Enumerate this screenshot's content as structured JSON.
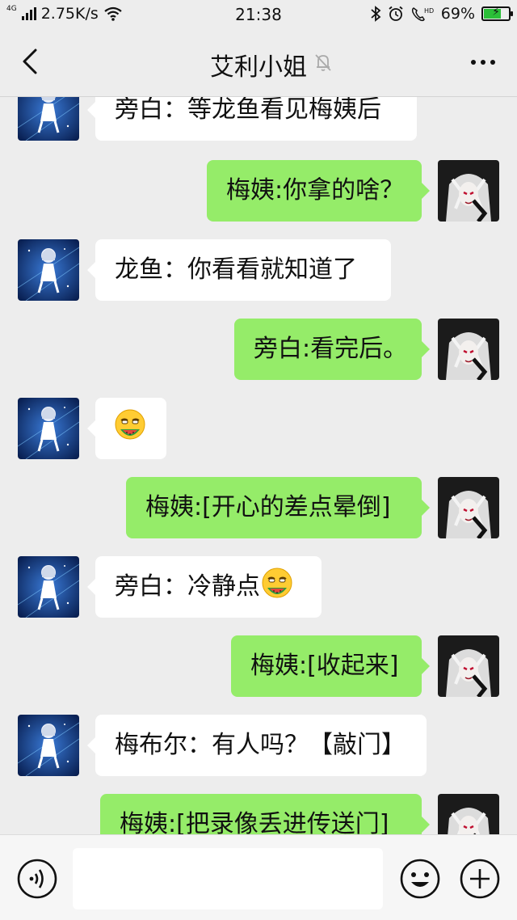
{
  "status_bar": {
    "network_type": "4G",
    "speed": "2.75K/s",
    "time": "21:38",
    "battery_text": "69%",
    "battery_level": 0.69
  },
  "header": {
    "title": "艾利小姐",
    "back_icon": "chevron-left-icon",
    "mute_icon": "bell-off-icon",
    "more_icon": "ellipsis-icon"
  },
  "messages": [
    {
      "side": "in",
      "text": "旁白：等龙鱼看见梅姨后"
    },
    {
      "side": "out",
      "text": "梅姨:你拿的啥？"
    },
    {
      "side": "in",
      "text": "龙鱼：你看看就知道了"
    },
    {
      "side": "out",
      "text": "旁白:看完后。"
    },
    {
      "side": "in",
      "text": "",
      "sticker": "grinning-melon-emoji"
    },
    {
      "side": "out",
      "text": "梅姨:[开心的差点晕倒]"
    },
    {
      "side": "in",
      "text": "旁白：冷静点",
      "sticker": "grinning-melon-emoji"
    },
    {
      "side": "out",
      "text": "梅姨:[收起来]"
    },
    {
      "side": "in",
      "text": "梅布尔：有人吗？【敲门】"
    },
    {
      "side": "out",
      "text": "梅姨:[把录像丢进传送门]"
    }
  ],
  "input_bar": {
    "voice_icon": "voice-icon",
    "emoji_icon": "smiley-icon",
    "plus_icon": "plus-circle-icon",
    "text_value": ""
  },
  "colors": {
    "background": "#ededed",
    "outgoing_bubble": "#95ec69",
    "incoming_bubble": "#ffffff",
    "battery_fill": "#2bbf38"
  }
}
